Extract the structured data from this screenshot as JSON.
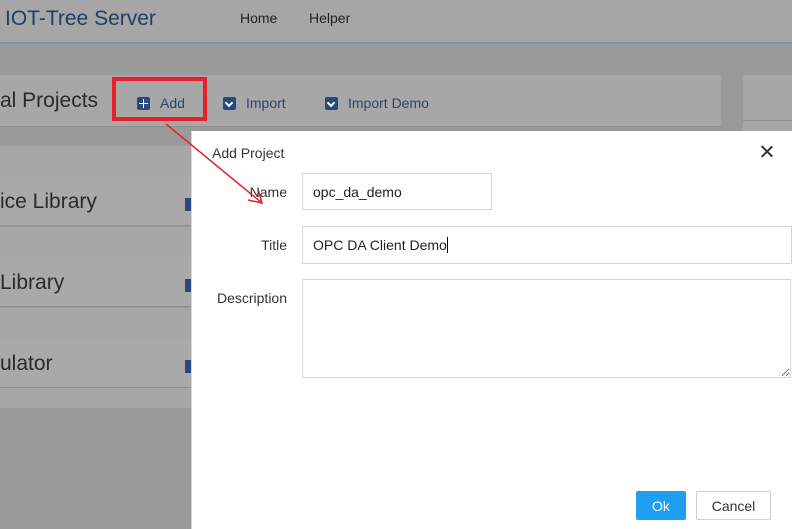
{
  "app": {
    "title": "IOT-Tree Server"
  },
  "nav": {
    "items": [
      "Home",
      "Helper"
    ]
  },
  "projects_panel": {
    "title": "al Projects",
    "buttons": {
      "add": "Add",
      "import": "Import",
      "import_demo": "Import Demo"
    }
  },
  "side_panels": [
    "ice Library",
    " Library",
    "ulator"
  ],
  "dialog": {
    "title": "Add Project",
    "fields": {
      "name": {
        "label": "Name",
        "value": "opc_da_demo"
      },
      "title": {
        "label": "Title",
        "value": "OPC DA Client Demo"
      },
      "description": {
        "label": "Description",
        "value": ""
      }
    },
    "ok_label": "Ok",
    "cancel_label": "Cancel"
  },
  "colors": {
    "highlight": "#e8202a",
    "primary_button": "#1e9ff2",
    "brand_text": "#1f3f66"
  }
}
